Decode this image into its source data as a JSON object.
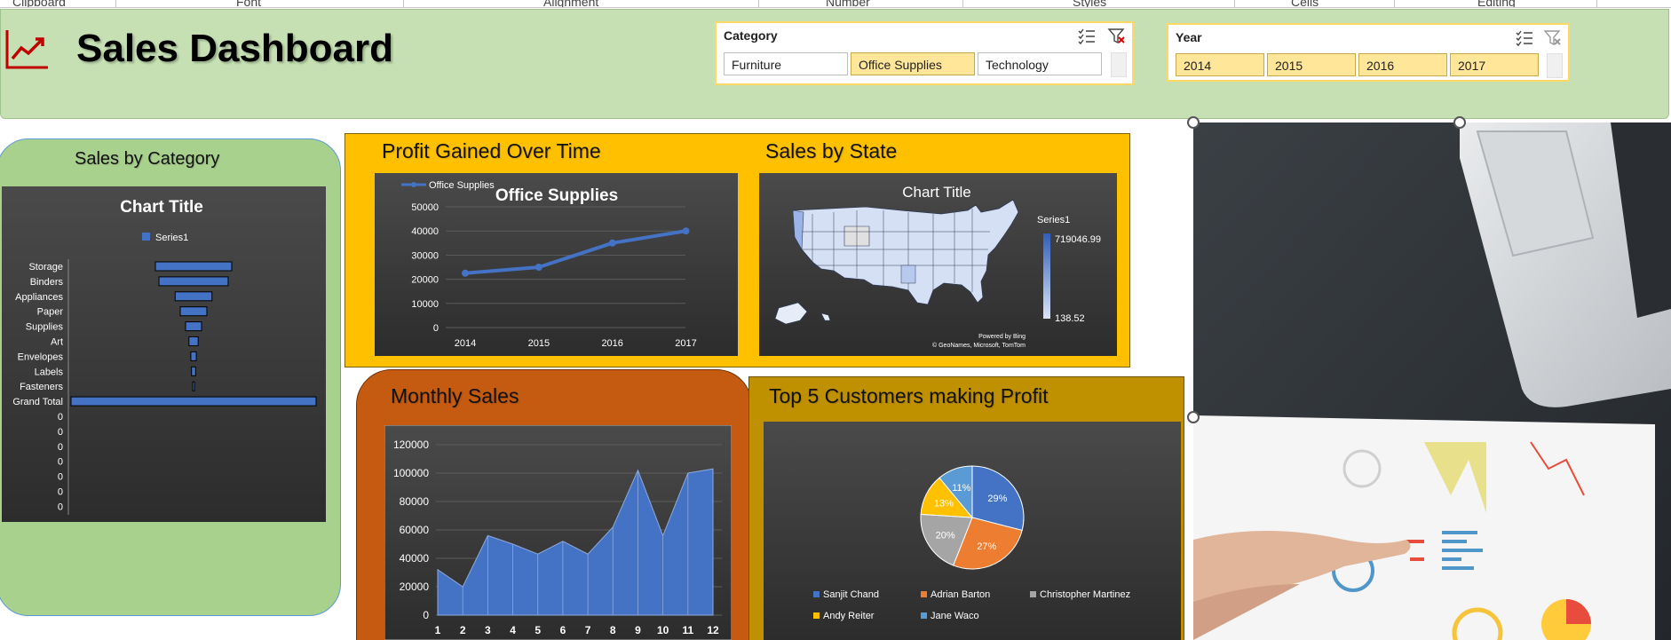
{
  "ribbon": {
    "groups": [
      "Clipboard",
      "Font",
      "Alignment",
      "Number",
      "Styles",
      "Cells",
      "Editing"
    ]
  },
  "header": {
    "title": "Sales Dashboard"
  },
  "slicers": {
    "category": {
      "title": "Category",
      "items": [
        "Furniture",
        "Office Supplies",
        "Technology"
      ],
      "selected": "Office Supplies"
    },
    "year": {
      "title": "Year",
      "items": [
        "2014",
        "2015",
        "2016",
        "2017"
      ],
      "selected": [
        "2014",
        "2015",
        "2016",
        "2017"
      ]
    }
  },
  "panels": {
    "sales_by_category": "Sales by Category",
    "profit_over_time": "Profit Gained Over Time",
    "sales_by_state": "Sales by State",
    "monthly_sales": "Monthly Sales",
    "top_customers": "Top 5 Customers making Profit"
  },
  "colors": {
    "header_bg": "#c6e0b4",
    "green_panel": "#a9d18e",
    "gold_panel": "#ffc000",
    "orange_panel": "#c55a11",
    "mustard_panel": "#bf9000",
    "series_blue": "#4472c4"
  },
  "map": {
    "title": "Chart Title",
    "legend_title": "Series1",
    "max_label": "719046.99",
    "min_label": "138.52",
    "credit1": "Powered by Bing",
    "credit2": "© GeoNames, Microsoft, TomTom"
  },
  "chart_data": [
    {
      "type": "bar",
      "title": "Chart Title",
      "legend": "Series1",
      "categories": [
        "Storage",
        "Binders",
        "Appliances",
        "Paper",
        "Supplies",
        "Art",
        "Envelopes",
        "Labels",
        "Fasteners",
        "Grand Total",
        "0",
        "0",
        "0",
        "0",
        "0",
        "0",
        "0"
      ],
      "values": [
        224,
        203,
        108,
        78,
        47,
        27,
        16,
        12,
        3,
        719,
        0,
        0,
        0,
        0,
        0,
        0,
        0
      ]
    },
    {
      "type": "line",
      "title": "Office Supplies",
      "legend": "Office Supplies",
      "x": [
        "2014",
        "2015",
        "2016",
        "2017"
      ],
      "values": [
        22500,
        25000,
        35000,
        40000
      ],
      "ylim": [
        0,
        50000
      ],
      "yticks": [
        "0",
        "10000",
        "20000",
        "30000",
        "40000",
        "50000"
      ]
    },
    {
      "type": "area",
      "x": [
        "1",
        "2",
        "3",
        "4",
        "5",
        "6",
        "7",
        "8",
        "9",
        "10",
        "11",
        "12"
      ],
      "values": [
        32000,
        20000,
        56000,
        50000,
        43000,
        52000,
        43000,
        62000,
        102000,
        56000,
        100000,
        103000
      ],
      "ylim": [
        0,
        120000
      ],
      "yticks": [
        "0",
        "20000",
        "40000",
        "60000",
        "80000",
        "100000",
        "120000"
      ]
    },
    {
      "type": "pie",
      "slices": [
        {
          "name": "Sanjit Chand",
          "value": 29,
          "label": "29%",
          "color": "#4472c4"
        },
        {
          "name": "Adrian Barton",
          "value": 27,
          "label": "27%",
          "color": "#ed7d31"
        },
        {
          "name": "Christopher Martinez",
          "value": 20,
          "label": "20%",
          "color": "#a5a5a5"
        },
        {
          "name": "Andy Reiter",
          "value": 13,
          "label": "13%",
          "color": "#ffc000"
        },
        {
          "name": "Jane Waco",
          "value": 11,
          "label": "11%",
          "color": "#5b9bd5"
        }
      ]
    }
  ]
}
